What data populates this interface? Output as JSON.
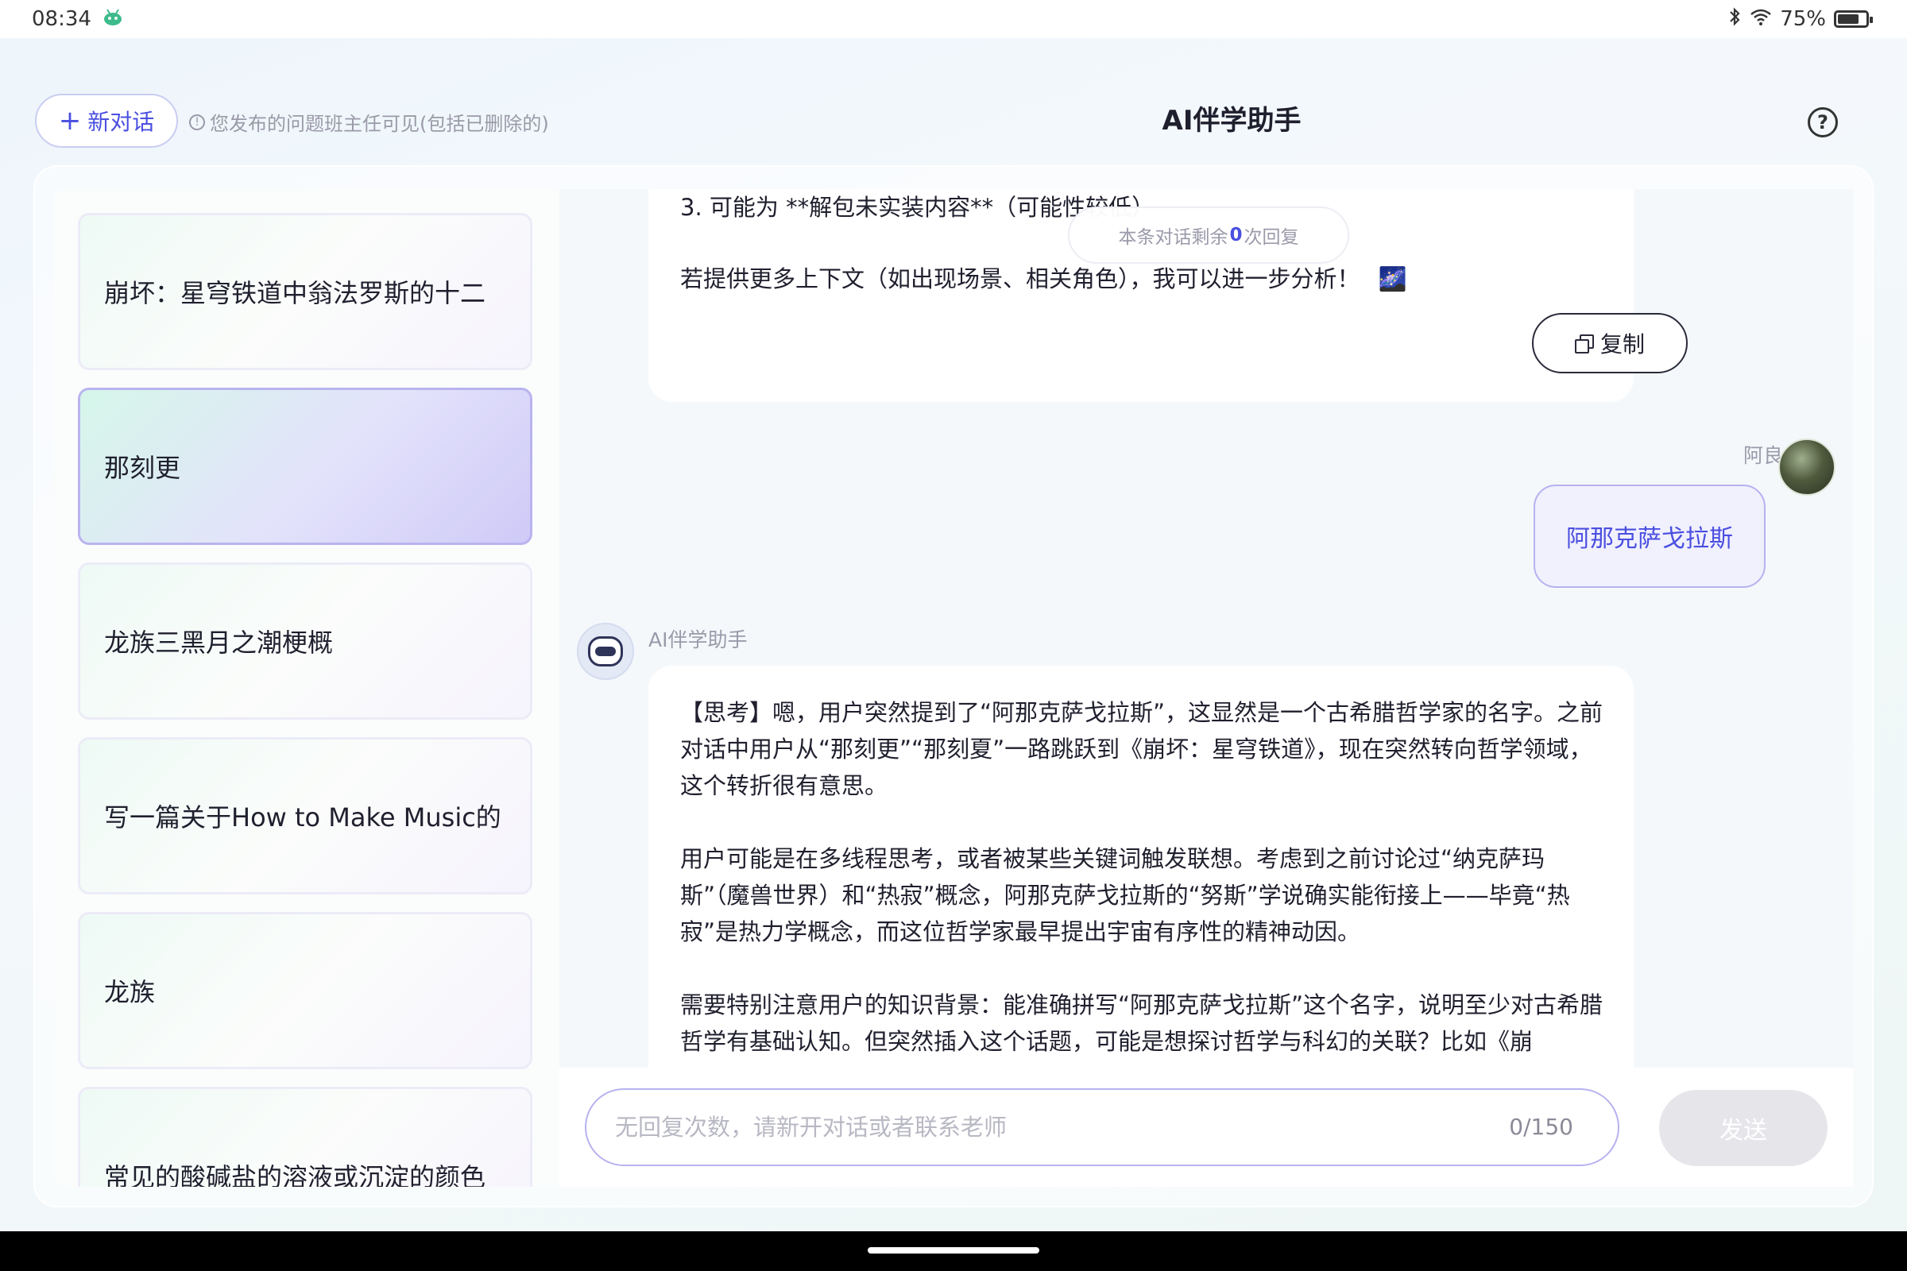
{
  "status_bar": {
    "time": "08:34",
    "battery": "75%",
    "battery_level": 0.75,
    "icons": [
      "android-icon",
      "bluetooth-icon",
      "wifi-icon",
      "battery-icon"
    ]
  },
  "header": {
    "new_chat_label": "新对话",
    "notice": "您发布的问题班主任可见(包括已删除的)",
    "title": "AI伴学助手"
  },
  "sidebar": {
    "items": [
      {
        "label": "崩坏：星穹铁道中翁法罗斯的十二",
        "active": false
      },
      {
        "label": "那刻更",
        "active": true
      },
      {
        "label": "龙族三黑月之潮梗概",
        "active": false
      },
      {
        "label": "写一篇关于How to Make Music的",
        "active": false
      },
      {
        "label": "龙族",
        "active": false
      },
      {
        "label": "常见的酸碱盐的溶液或沉淀的颜色",
        "active": false
      }
    ]
  },
  "chat": {
    "prev_message": {
      "line1": "3. 可能为 **解包未实装内容**（可能性较低）",
      "line2": "若提供更多上下文（如出现场景、相关角色），我可以进一步分析！",
      "emoji": "🌌",
      "copy_label": "复制"
    },
    "remaining": {
      "prefix": "本条对话剩余",
      "count": "0",
      "suffix": "次回复"
    },
    "user": {
      "name": "阿良",
      "message": "阿那克萨戈拉斯"
    },
    "bot": {
      "name": "AI伴学助手",
      "paragraphs": [
        "【思考】嗯，用户突然提到了“阿那克萨戈拉斯”，这显然是一个古希腊哲学家的名字。之前对话中用户从“那刻更”“那刻夏”一路跳跃到《崩坏：星穹铁道》，现在突然转向哲学领域，这个转折很有意思。",
        "用户可能是在多线程思考，或者被某些关键词触发联想。考虑到之前讨论过“纳克萨玛斯”（魔兽世界）和“热寂”概念，阿那克萨戈拉斯的“努斯”学说确实能衔接上——毕竟“热寂”是热力学概念，而这位哲学家最早提出宇宙有序性的精神动因。",
        "需要特别注意用户的知识背景：能准确拼写“阿那克萨戈拉斯”这个名字，说明至少对古希腊哲学有基础认知。但突然插入这个话题，可能是想探讨哲学与科幻的关联？比如《崩"
      ]
    }
  },
  "input": {
    "placeholder": "无回复次数，请新开对话或者联系老师",
    "counter": "0/150",
    "send_label": "发送"
  },
  "colors": {
    "accent": "#4a4fe0",
    "active_border": "#b9b4ee",
    "muted_text": "#9a9aaa"
  }
}
